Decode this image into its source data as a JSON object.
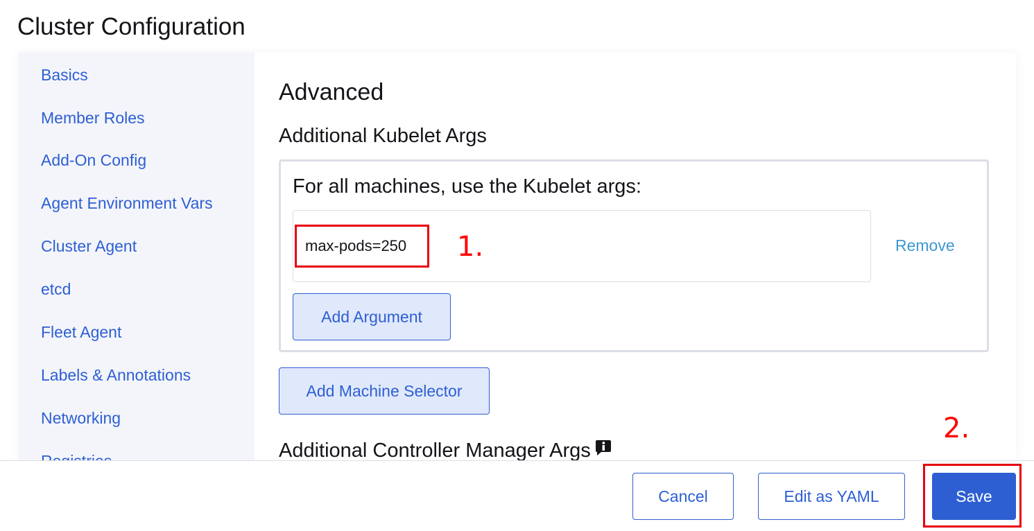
{
  "page": {
    "title": "Cluster Configuration"
  },
  "sidebar": {
    "items": [
      {
        "label": "Basics"
      },
      {
        "label": "Member Roles"
      },
      {
        "label": "Add-On Config"
      },
      {
        "label": "Agent Environment Vars"
      },
      {
        "label": "Cluster Agent"
      },
      {
        "label": "etcd"
      },
      {
        "label": "Fleet Agent"
      },
      {
        "label": "Labels & Annotations"
      },
      {
        "label": "Networking"
      },
      {
        "label": "Registries"
      }
    ]
  },
  "main": {
    "heading": "Advanced",
    "kubelet": {
      "title": "Additional Kubelet Args",
      "box_label": "For all machines, use the Kubelet args:",
      "arg_value": "max-pods=250",
      "remove_label": "Remove",
      "add_argument_label": "Add Argument"
    },
    "add_machine_selector_label": "Add Machine Selector",
    "controller_manager_title": "Additional Controller Manager Args"
  },
  "footer": {
    "cancel_label": "Cancel",
    "edit_yaml_label": "Edit as YAML",
    "save_label": "Save"
  },
  "annotations": {
    "step1": "1.",
    "step2": "2."
  },
  "icons": {
    "info": "info-icon"
  },
  "colors": {
    "accent": "#2d5fd3",
    "link_remove": "#3d98d3",
    "annotation_red": "#ff0000",
    "sidebar_bg": "#f4f5fa"
  }
}
